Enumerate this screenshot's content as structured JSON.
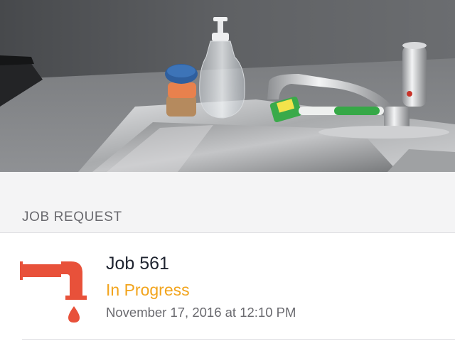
{
  "photo": {
    "subject": "kitchen-sink-photo"
  },
  "section": {
    "title": "JOB REQUEST"
  },
  "job": {
    "title": "Job 561",
    "status": "In Progress",
    "status_color": "#f2a41c",
    "date": "November 17, 2016 at 12:10 PM",
    "icon": "faucet-drip-icon",
    "icon_color": "#e8513a"
  }
}
